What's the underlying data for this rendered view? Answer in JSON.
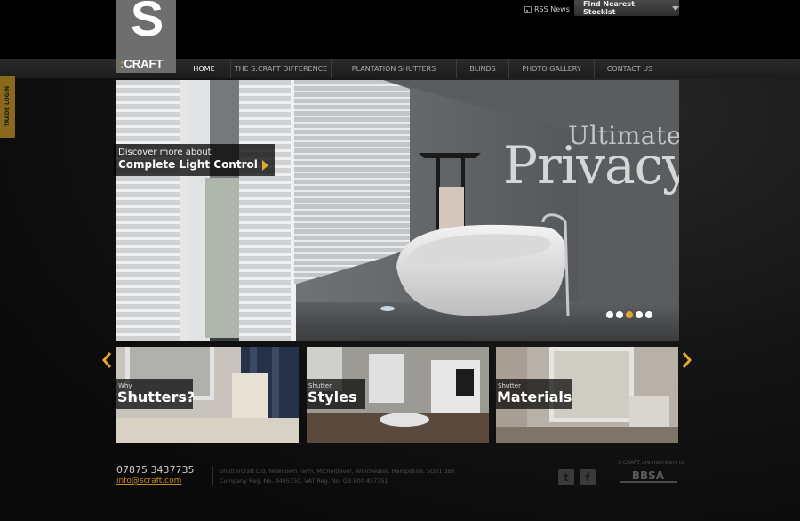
{
  "brand": {
    "logo_letter": "S",
    "logo_name": "CRAFT",
    "logo_colon": ":"
  },
  "header": {
    "rss_label": "RSS News",
    "stockist_label": "Find Nearest Stockist"
  },
  "nav": {
    "items": [
      {
        "label": "HOME",
        "active": true
      },
      {
        "label": "THE S:CRAFT DIFFERENCE"
      },
      {
        "label": "PLANTATION SHUTTERS"
      },
      {
        "label": "BLINDS"
      },
      {
        "label": "PHOTO GALLERY"
      },
      {
        "label": "CONTACT US"
      }
    ]
  },
  "trade_login": {
    "label": "TRADE LOGIN"
  },
  "hero": {
    "headline_top": "Ultimate",
    "headline_main": "Privacy",
    "discover_line1": "Discover more about",
    "discover_line2": "Complete Light Control",
    "slide_count": 5,
    "active_slide": 3
  },
  "tiles": [
    {
      "small": "Why",
      "big": "Shutters?"
    },
    {
      "small": "Shutter",
      "big": "Styles"
    },
    {
      "small": "Shutter",
      "big": "Materials"
    }
  ],
  "footer": {
    "phone": "07875 3437735",
    "email": "info@scraft.com",
    "address": "Shuttercraft Ltd, Newdown Farm, Micheldever, Winchester, Hampshire, SO21 3BT",
    "reg": "Company Reg. No.  4495750, VAT Reg. No.  GB 800 457751",
    "members_label": "S:CRAFT are members of",
    "bbsa_label": "BBSA"
  },
  "colors": {
    "accent": "#e0a82e",
    "email": "#c68a1e",
    "trade_tab": "#8a6a1a"
  },
  "icons": {
    "rss": "rss-icon",
    "stockist": "chevron-down-icon",
    "twitter": "twitter-icon",
    "facebook": "facebook-icon",
    "prev": "chevron-left-icon",
    "next": "chevron-right-icon"
  }
}
